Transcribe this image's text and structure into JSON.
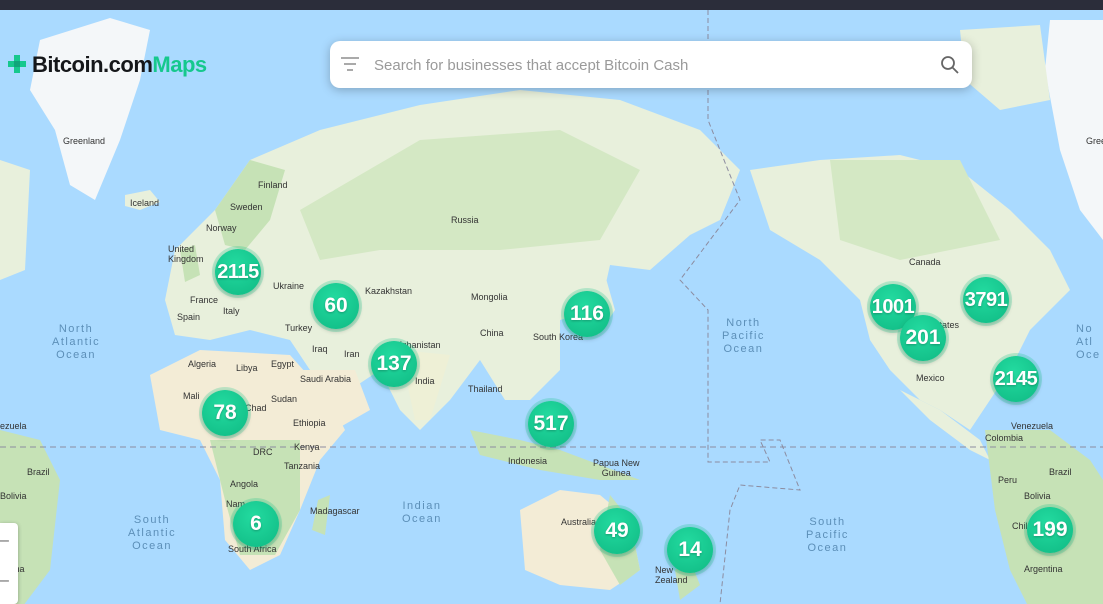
{
  "app": {
    "logo_main": "Bitcoin.com",
    "logo_accent": "Maps"
  },
  "search": {
    "placeholder": "Search for businesses that accept Bitcoin Cash"
  },
  "colors": {
    "cluster": "#16c88d",
    "ocean": "#aadaff",
    "land": "#e8f0dc",
    "forest": "#c6e2b6",
    "desert": "#f3ecd6"
  },
  "map": {
    "oceans": {
      "north_atlantic_w": "North\nAtlantic\nOcean",
      "north_pacific": "North\nPacific\nOcean",
      "indian": "Indian\nOcean",
      "south_atlantic": "South\nAtlantic\nOcean",
      "south_pacific": "South\nPacific\nOcean",
      "north_atlantic_e": "No\nAtl\nOce"
    },
    "labels": {
      "greenland": "Greenland",
      "greenland_e": "Gree",
      "iceland": "Iceland",
      "finland": "Finland",
      "sweden": "Sweden",
      "norway": "Norway",
      "russia": "Russia",
      "united_kingdom": "United\nKingdom",
      "ukraine": "Ukraine",
      "kazakhstan": "Kazakhstan",
      "mongolia": "Mongolia",
      "france": "France",
      "spain": "Spain",
      "italy": "Italy",
      "turkey": "Turkey",
      "china": "China",
      "south_korea": "South Korea",
      "iraq": "Iraq",
      "iran": "Iran",
      "afghanistan": "Afghanistan",
      "algeria": "Algeria",
      "libya": "Libya",
      "egypt": "Egypt",
      "saudi_arabia": "Saudi Arabia",
      "india": "India",
      "thailand": "Thailand",
      "mali": "Mali",
      "chad": "Chad",
      "sudan": "Sudan",
      "ethiopia": "Ethiopia",
      "kenya": "Kenya",
      "drc": "DRC",
      "tanzania": "Tanzania",
      "angola": "Angola",
      "namibia": "Nam",
      "madagascar": "Madagascar",
      "south_africa": "South Africa",
      "indonesia": "Indonesia",
      "papua_new_guinea": "Papua New\nGuinea",
      "australia": "Australia",
      "new_zealand": "New\nZealand",
      "canada": "Canada",
      "united_states": "United States",
      "mexico": "Mexico",
      "venezuela_w": "ezuela",
      "venezuela": "Venezuela",
      "colombia": "Colombia",
      "brazil_w": "Brazil",
      "brazil": "Brazil",
      "bolivia_w": "Bolivia",
      "bolivia": "Bolivia",
      "peru": "Peru",
      "chile": "Chile",
      "argentina_w": "entina",
      "argentina": "Argentina"
    },
    "clusters": {
      "europe": "2115",
      "central_asia": "60",
      "east_asia": "116",
      "south_asia": "137",
      "africa_west": "78",
      "southeast_asia": "517",
      "south_africa": "6",
      "australia": "49",
      "new_zealand": "14",
      "us_west": "1001",
      "us_east": "3791",
      "mexico": "201",
      "caribbean": "2145",
      "south_america": "199"
    }
  }
}
